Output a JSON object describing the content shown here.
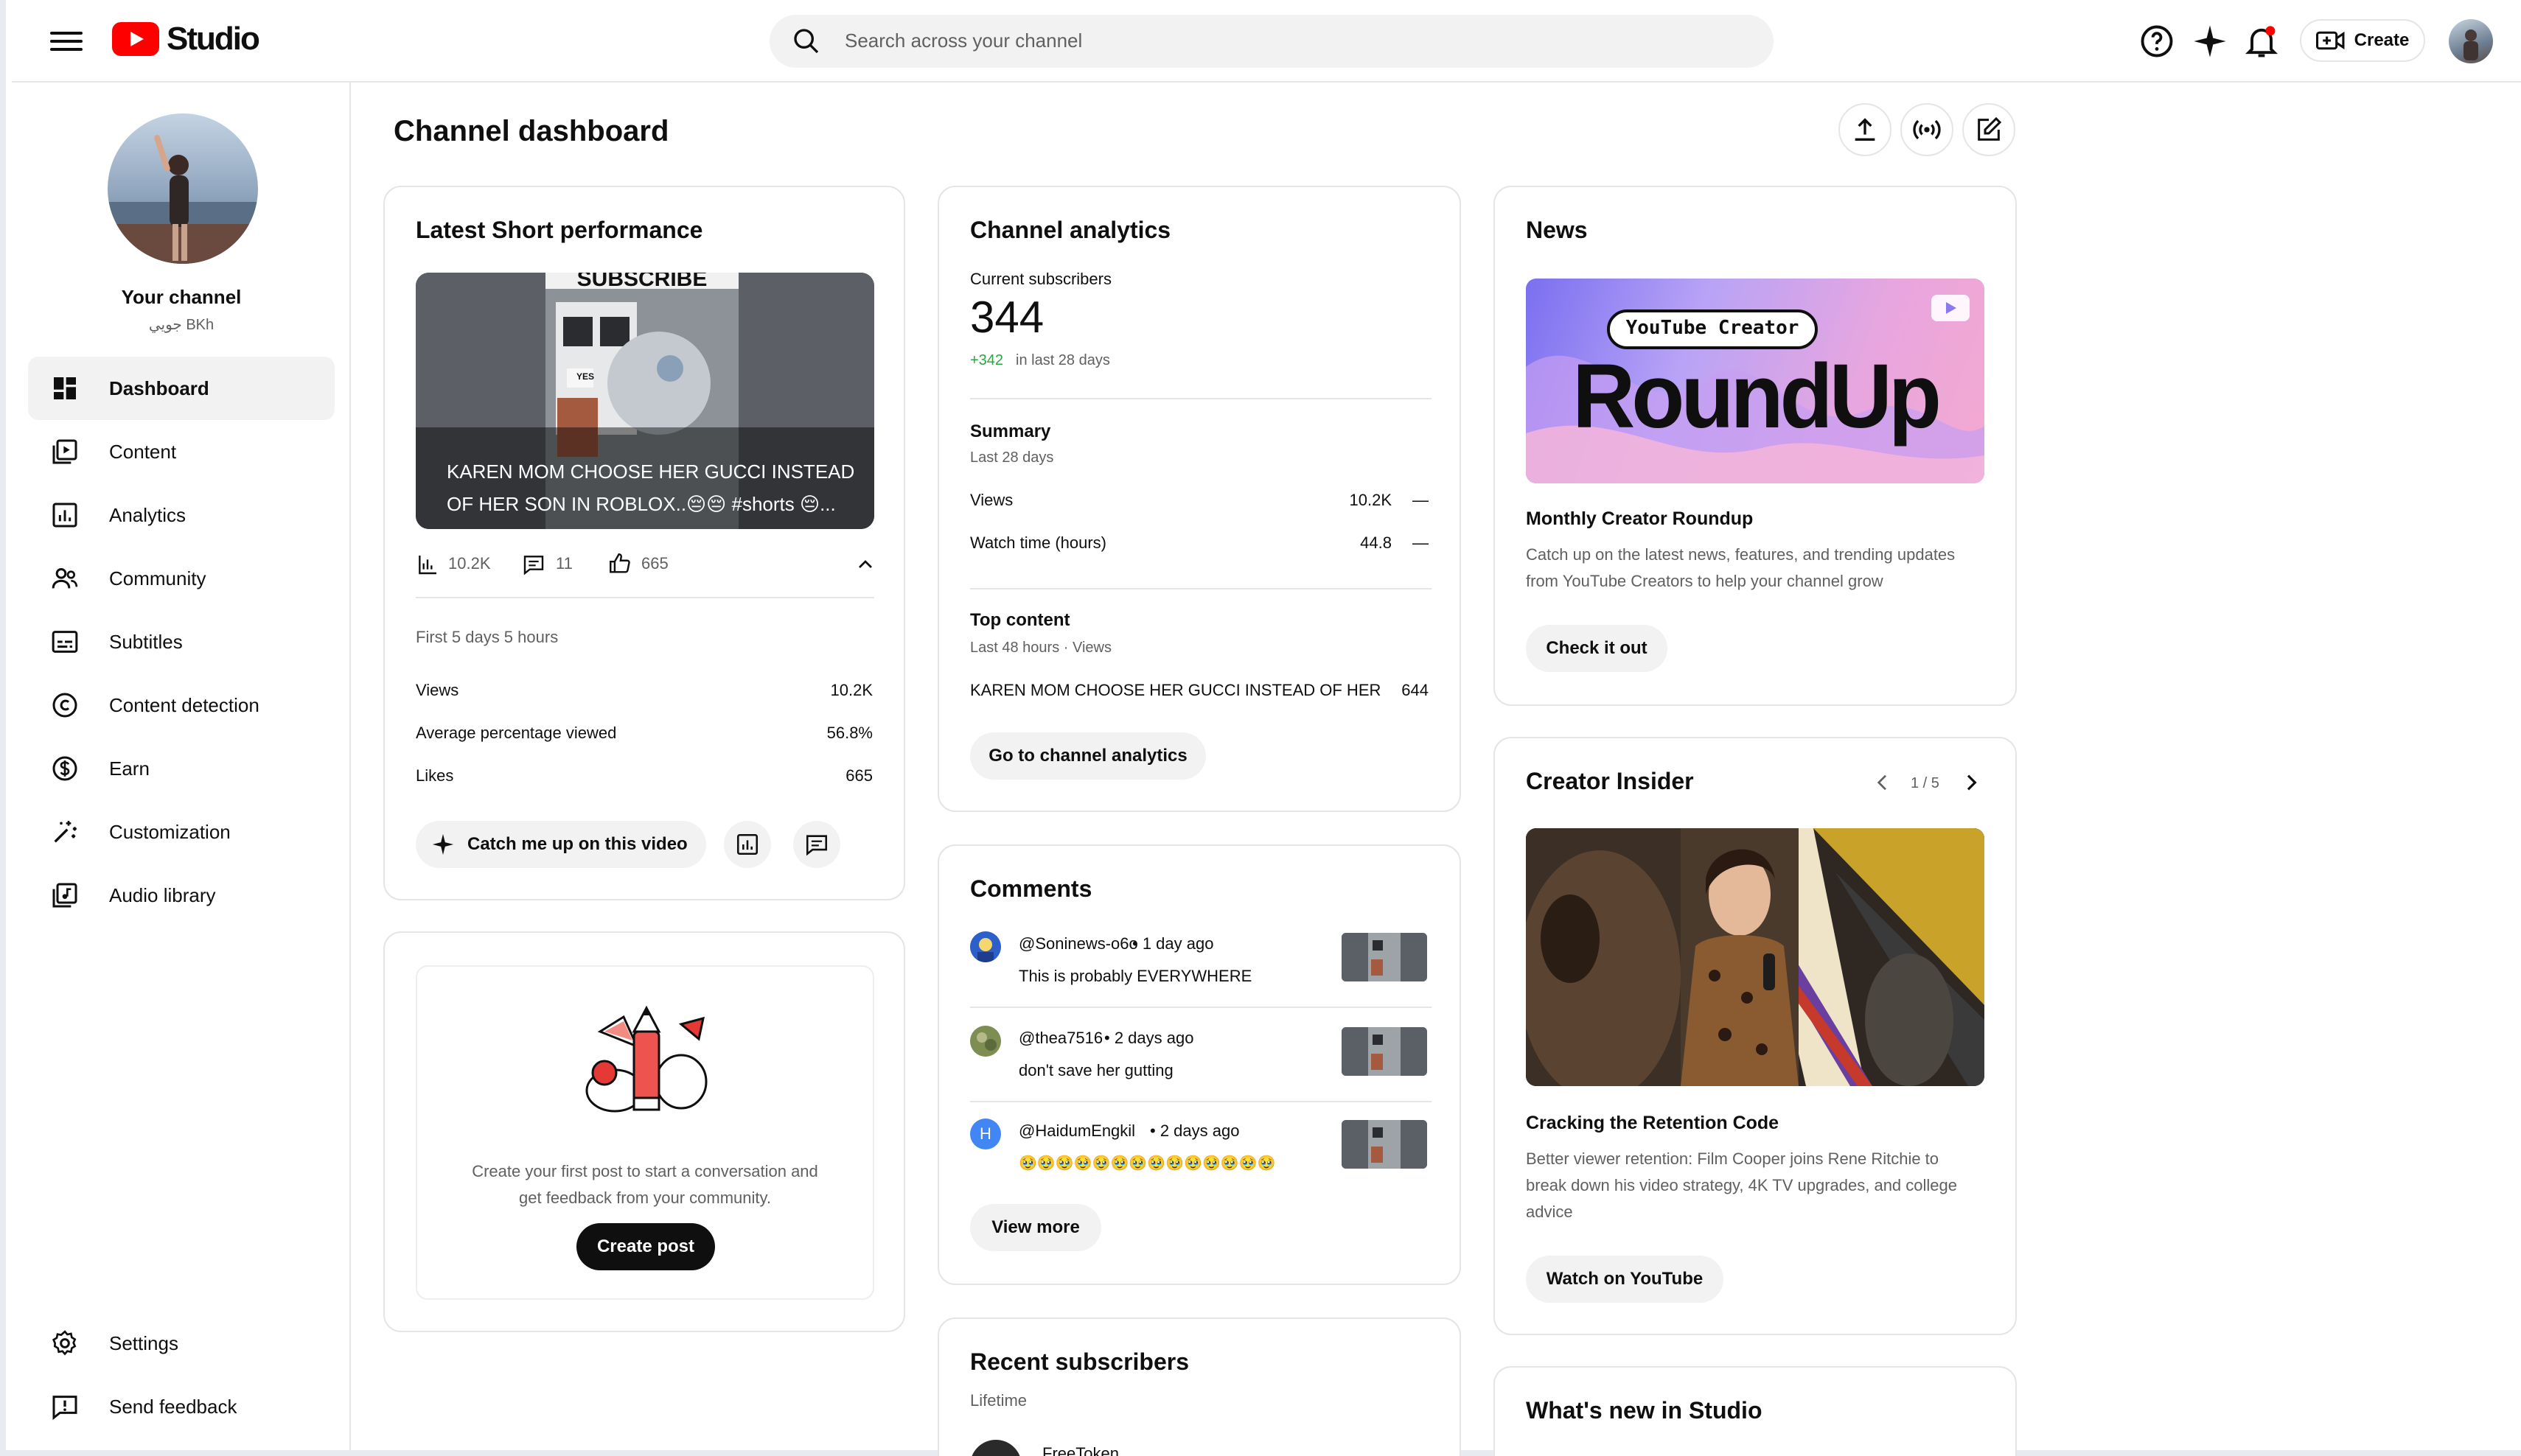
{
  "app": {
    "logo_text": "Studio"
  },
  "search": {
    "placeholder": "Search across your channel"
  },
  "header": {
    "create_label": "Create"
  },
  "channel": {
    "title": "Your channel",
    "subtitle": "جويي BKh"
  },
  "nav": {
    "items": [
      {
        "label": "Dashboard",
        "icon": "dashboard-icon"
      },
      {
        "label": "Content",
        "icon": "content-icon"
      },
      {
        "label": "Analytics",
        "icon": "analytics-icon"
      },
      {
        "label": "Community",
        "icon": "community-icon"
      },
      {
        "label": "Subtitles",
        "icon": "subtitles-icon"
      },
      {
        "label": "Content detection",
        "icon": "copyright-icon"
      },
      {
        "label": "Earn",
        "icon": "dollar-icon"
      },
      {
        "label": "Customization",
        "icon": "magic-wand-icon"
      },
      {
        "label": "Audio library",
        "icon": "audio-library-icon"
      }
    ],
    "bottom": [
      {
        "label": "Settings",
        "icon": "gear-icon"
      },
      {
        "label": "Send feedback",
        "icon": "feedback-icon"
      }
    ]
  },
  "page": {
    "title": "Channel dashboard"
  },
  "latest_short": {
    "title": "Latest Short performance",
    "thumb_top_text": "SUBSCRIBE",
    "thumb_sign_text": "YES",
    "caption": "KAREN MOM CHOOSE HER GUCCI INSTEAD OF HER SON IN ROBLOX..😔😔 #shorts 😔...",
    "views": "10.2K",
    "comments": "11",
    "likes": "665",
    "period": "First 5 days 5 hours",
    "rows": [
      {
        "label": "Views",
        "value": "10.2K"
      },
      {
        "label": "Average percentage viewed",
        "value": "56.8%"
      },
      {
        "label": "Likes",
        "value": "665"
      }
    ],
    "catch_me_up": "Catch me up on this video"
  },
  "post_card": {
    "text_line1": "Create your first post to start a conversation and",
    "text_line2": "get feedback from your community.",
    "button": "Create post"
  },
  "analytics": {
    "title": "Channel analytics",
    "current_label": "Current subscribers",
    "subscribers": "344",
    "delta": "+342",
    "delta_suffix": "in last 28 days",
    "summary_title": "Summary",
    "summary_period": "Last 28 days",
    "summary_rows": [
      {
        "label": "Views",
        "value": "10.2K",
        "trend": "—"
      },
      {
        "label": "Watch time (hours)",
        "value": "44.8",
        "trend": "—"
      }
    ],
    "top_title": "Top content",
    "top_period": "Last 48 hours · Views",
    "top_item": "KAREN MOM CHOOSE HER GUCCI INSTEAD OF HER ...",
    "top_value": "644",
    "button": "Go to channel analytics"
  },
  "comments": {
    "title": "Comments",
    "items": [
      {
        "name": "@Soninews-o6o",
        "time": "• 1 day ago",
        "text": "This is probably EVERYWHERE",
        "avatar_color": "#3b6dd8"
      },
      {
        "name": "@thea7516",
        "time": "• 2 days ago",
        "text": "don't save her gutting",
        "avatar_color": "#8a9a5b"
      },
      {
        "name": "@HaidumEngkil",
        "time": "• 2 days ago",
        "text": "🥹🥹🥹🥹🥹🥹🥹🥹🥹🥹🥹🥹🥹🥹",
        "avatar_letter": "H",
        "avatar_color": "#4285f4"
      }
    ],
    "button": "View more"
  },
  "recent_subscribers": {
    "title": "Recent subscribers",
    "period": "Lifetime",
    "partial_name": "FreeToken"
  },
  "news": {
    "title": "News",
    "image_label": "YouTube Creator",
    "image_headline": "RoundUp",
    "headline": "Monthly Creator Roundup",
    "desc_line1": "Catch up on the latest news, features, and trending updates",
    "desc_line2": "from YouTube Creators to help your channel grow",
    "button": "Check it out"
  },
  "insider": {
    "title": "Creator Insider",
    "pager": "1 / 5",
    "headline": "Cracking the Retention Code",
    "desc_line1": "Better viewer retention: Film Cooper joins Rene Ritchie to",
    "desc_line2": "break down his video strategy, 4K TV upgrades, and college",
    "desc_line3": "advice",
    "button": "Watch on YouTube"
  },
  "whats_new": {
    "title": "What's new in Studio"
  },
  "colors": {
    "brand_red": "#ff0000",
    "accent_green": "#2ba640"
  }
}
